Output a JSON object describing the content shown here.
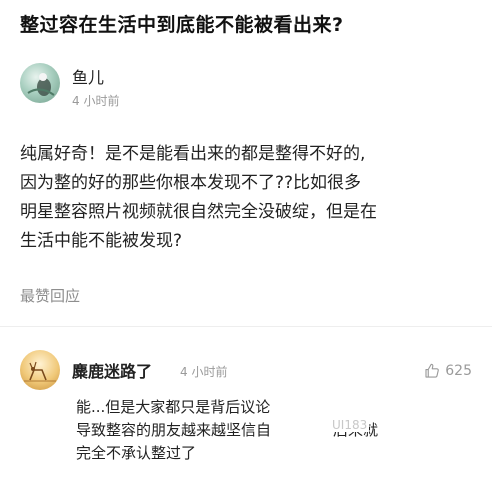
{
  "question": {
    "title": "整过容在生活中到底能不能被看出来?"
  },
  "author": {
    "name": "鱼儿",
    "time": "4 小时前"
  },
  "post": {
    "lines": [
      "纯属好奇！是不是能看出来的都是整得不好的,",
      "因为整的好的那些你根本发现不了??比如很多",
      "明星整容照片视频就很自然完全没破绽，但是在",
      "生活中能不能被发现?"
    ]
  },
  "reply_link": "最赞回应",
  "comment": {
    "name": "麋鹿迷路了",
    "time": "4 小时前",
    "likes": "625",
    "lines": [
      "能...但是大家都只是背后议论",
      "导致整容的朋友越来越坚信自",
      "完全不承认整过了"
    ],
    "line2_tail": "后来就",
    "watermark": "UI183"
  },
  "colors": {
    "text": "#222222",
    "muted": "#9a9a9a"
  },
  "icons": [
    "avatar-fish",
    "avatar-deer",
    "thumbs-up-icon"
  ]
}
